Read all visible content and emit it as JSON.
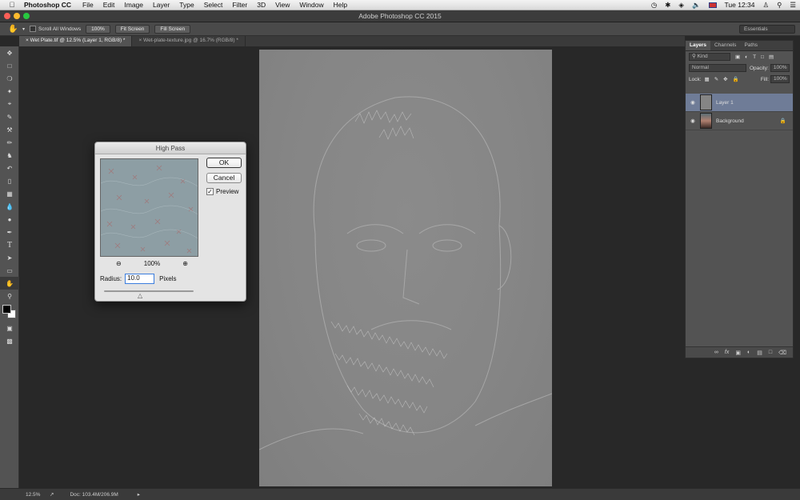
{
  "menubar": {
    "app_name": "Photoshop CC",
    "menus": [
      "File",
      "Edit",
      "Image",
      "Layer",
      "Type",
      "Select",
      "Filter",
      "3D",
      "View",
      "Window",
      "Help"
    ],
    "clock": "Tue 12:34"
  },
  "window": {
    "title": "Adobe Photoshop CC 2015"
  },
  "options_bar": {
    "scroll_all_windows": "Scroll All Windows",
    "btn_100": "100%",
    "btn_fit": "Fit Screen",
    "btn_fill": "Fill Screen",
    "workspace": "Essentials"
  },
  "tabs": [
    {
      "label": "Wet Plate.tif @ 12.5% (Layer 1, RGB/8) *"
    },
    {
      "label": "Wet-plate-texture.jpg @ 16.7% (RGB/8) *"
    }
  ],
  "dialog": {
    "title": "High Pass",
    "ok": "OK",
    "cancel": "Cancel",
    "preview_label": "Preview",
    "preview_checked": true,
    "zoom": "100%",
    "radius_label": "Radius:",
    "radius_value": "10.0",
    "radius_unit": "Pixels"
  },
  "layers_panel": {
    "tabs": [
      "Layers",
      "Channels",
      "Paths"
    ],
    "kind": "Kind",
    "blend_mode": "Normal",
    "opacity_label": "Opacity:",
    "opacity_value": "100%",
    "lock_label": "Lock:",
    "fill_label": "Fill:",
    "fill_value": "100%",
    "layers": [
      {
        "name": "Layer 1",
        "selected": true
      },
      {
        "name": "Background",
        "selected": false
      }
    ]
  },
  "status": {
    "zoom": "12.5%",
    "doc": "Doc: 103.4M/206.9M"
  },
  "colors": {
    "accent": "#3b7ddd",
    "selected_layer": "#6f7c97",
    "canvas_gray": "#858585"
  }
}
